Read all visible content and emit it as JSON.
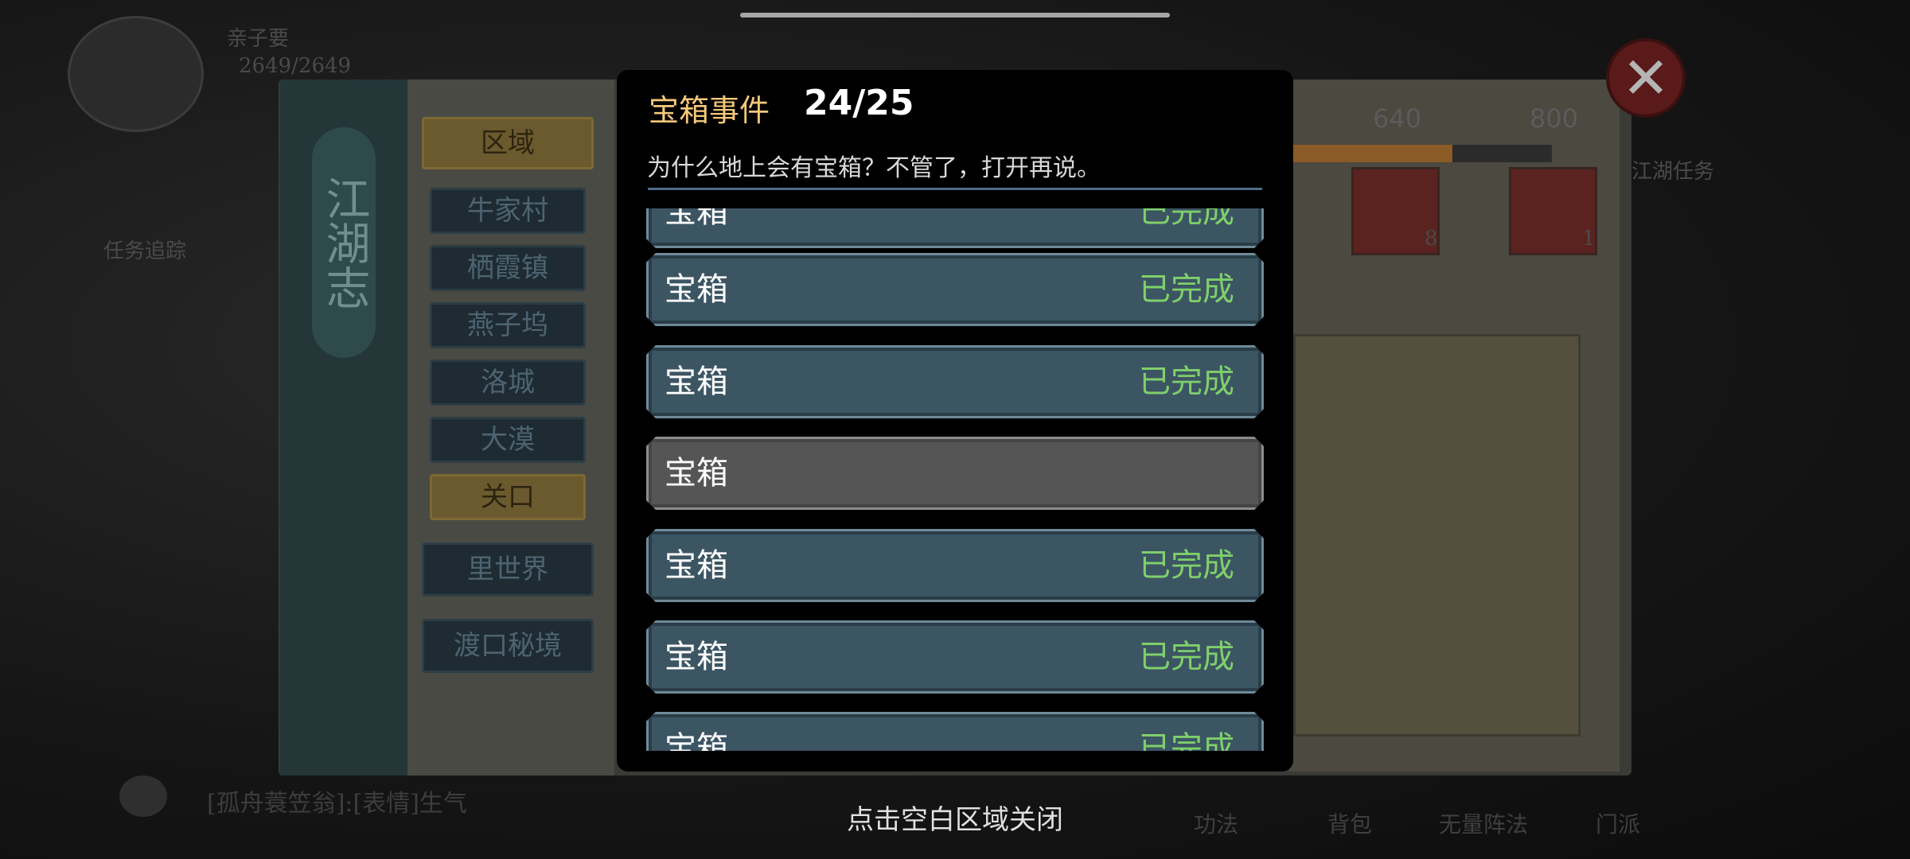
{
  "background": {
    "player_name": "亲子要",
    "hp": "2649/2649",
    "book_title": "江湖志",
    "region_header": "区域",
    "regions": [
      "牛家村",
      "栖霞镇",
      "燕子坞",
      "洛城",
      "大漠",
      "关口"
    ],
    "active_region": "关口",
    "extra_regions": [
      "里世界",
      "渡口秘境"
    ],
    "milestones": [
      "640",
      "800"
    ],
    "reward_counts": [
      "8",
      "1"
    ],
    "quest_tab": "江湖任务",
    "task_tracker": "任务追踪",
    "chat_text": "[孤舟蓑笠翁]:[表情]生气",
    "bottom_nav": [
      "功法",
      "背包",
      "无量阵法",
      "门派"
    ]
  },
  "modal": {
    "title": "宝箱事件",
    "count": "24/25",
    "description": "为什么地上会有宝箱？不管了，打开再说。",
    "rows": [
      {
        "name": "宝箱",
        "status": "已完成"
      },
      {
        "name": "宝箱",
        "status": "已完成"
      },
      {
        "name": "宝箱",
        "status": "已完成"
      },
      {
        "name": "宝箱",
        "status": ""
      },
      {
        "name": "宝箱",
        "status": "已完成"
      },
      {
        "name": "宝箱",
        "status": "已完成"
      },
      {
        "name": "宝箱",
        "status": "已完成"
      }
    ]
  },
  "footer_hint": "点击空白区域关闭",
  "colors": {
    "title_gold": "#f5c87a",
    "completed_green": "#7ed06b",
    "row_blue": "#3c5563",
    "row_gray": "#555555"
  },
  "icons": {
    "close": "close-icon",
    "chat": "chat-bubble-icon"
  }
}
